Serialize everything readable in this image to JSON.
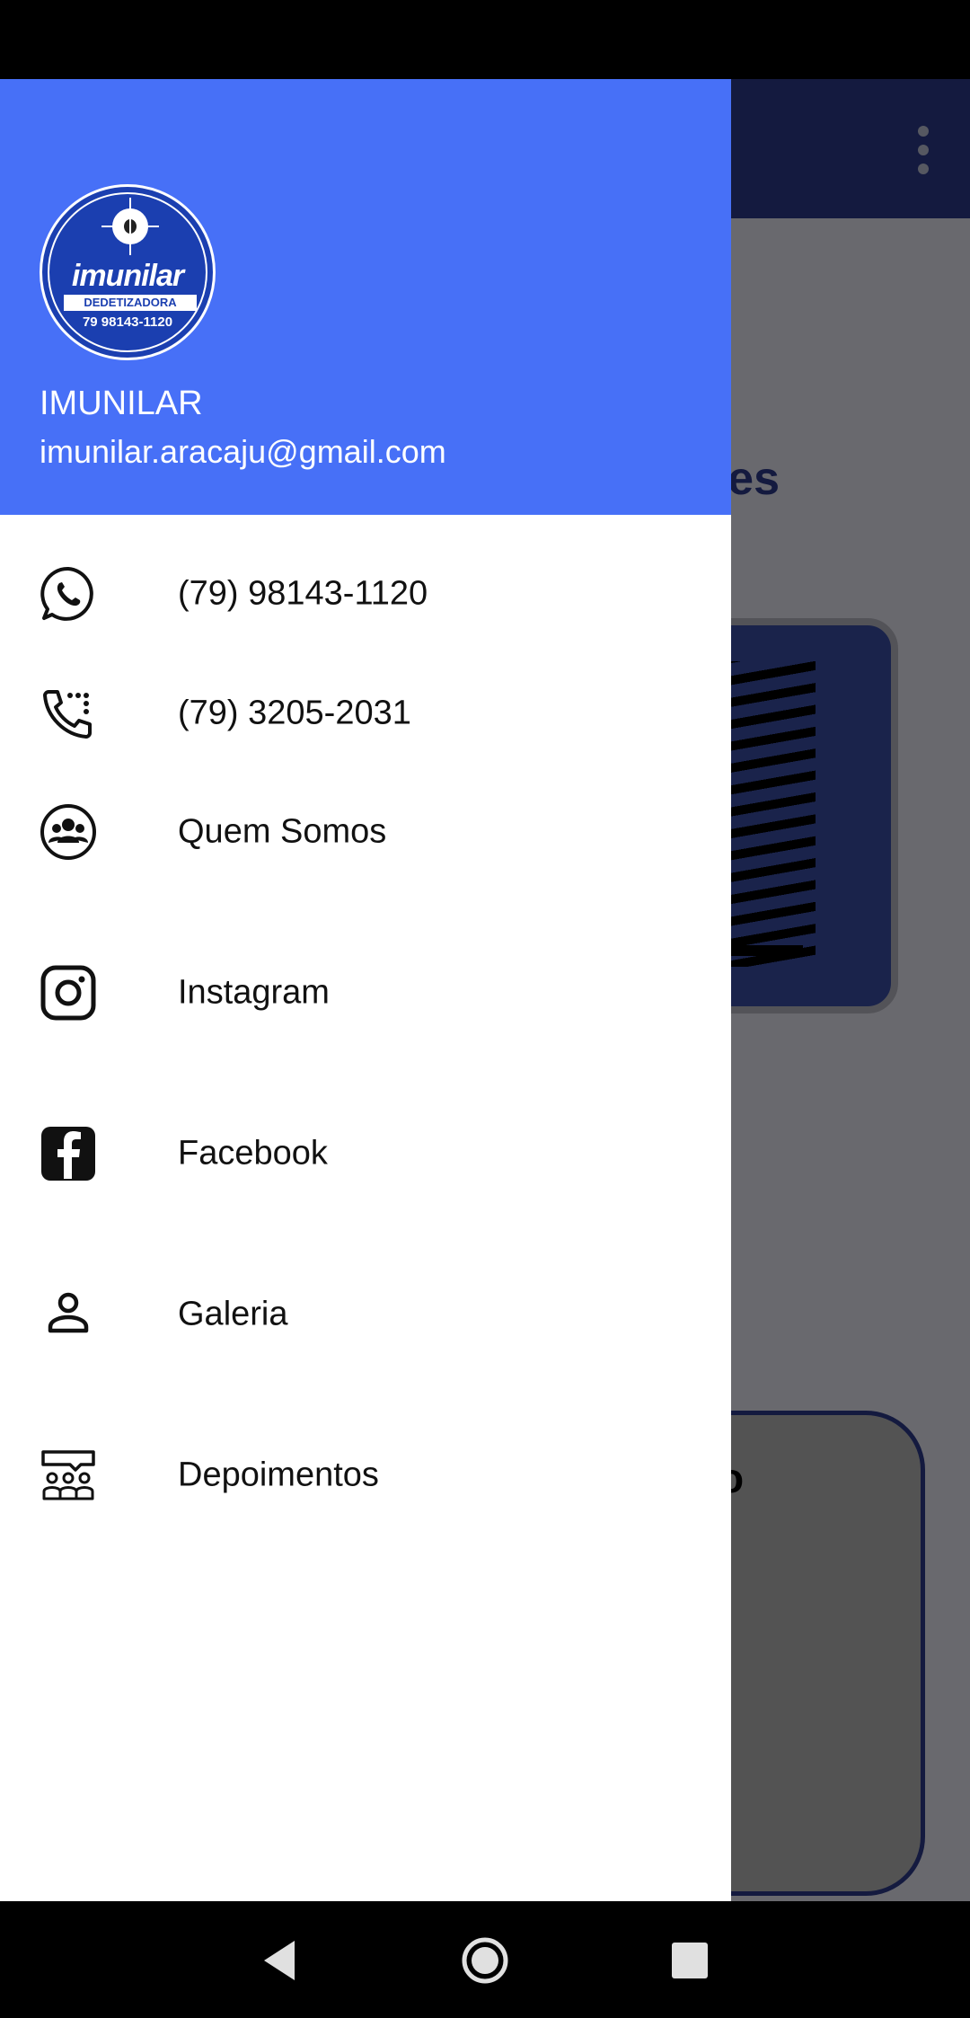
{
  "drawer": {
    "user_name": "IMUNILAR",
    "user_email": "imunilar.aracaju@gmail.com",
    "logo": {
      "brand": "imunilar",
      "subtitle": "DEDETIZADORA",
      "phone": "79 98143-1120"
    },
    "items": [
      {
        "label": "(79) 98143-1120",
        "icon": "whatsapp-icon"
      },
      {
        "label": "(79) 3205-2031",
        "icon": "phone-dialpad-icon"
      },
      {
        "label": "Quem Somos",
        "icon": "group-icon"
      },
      {
        "label": "Instagram",
        "icon": "instagram-icon"
      },
      {
        "label": "Facebook",
        "icon": "facebook-icon"
      },
      {
        "label": "Galeria",
        "icon": "person-icon"
      },
      {
        "label": "Depoimentos",
        "icon": "testimonials-icon"
      }
    ]
  },
  "background": {
    "heading_fragment": "es",
    "box_letter_fragment": "o"
  },
  "colors": {
    "drawer_header": "#4770f7",
    "toolbar": "#2d3a8c",
    "scrim": "rgba(0,0,0,0.55)"
  }
}
